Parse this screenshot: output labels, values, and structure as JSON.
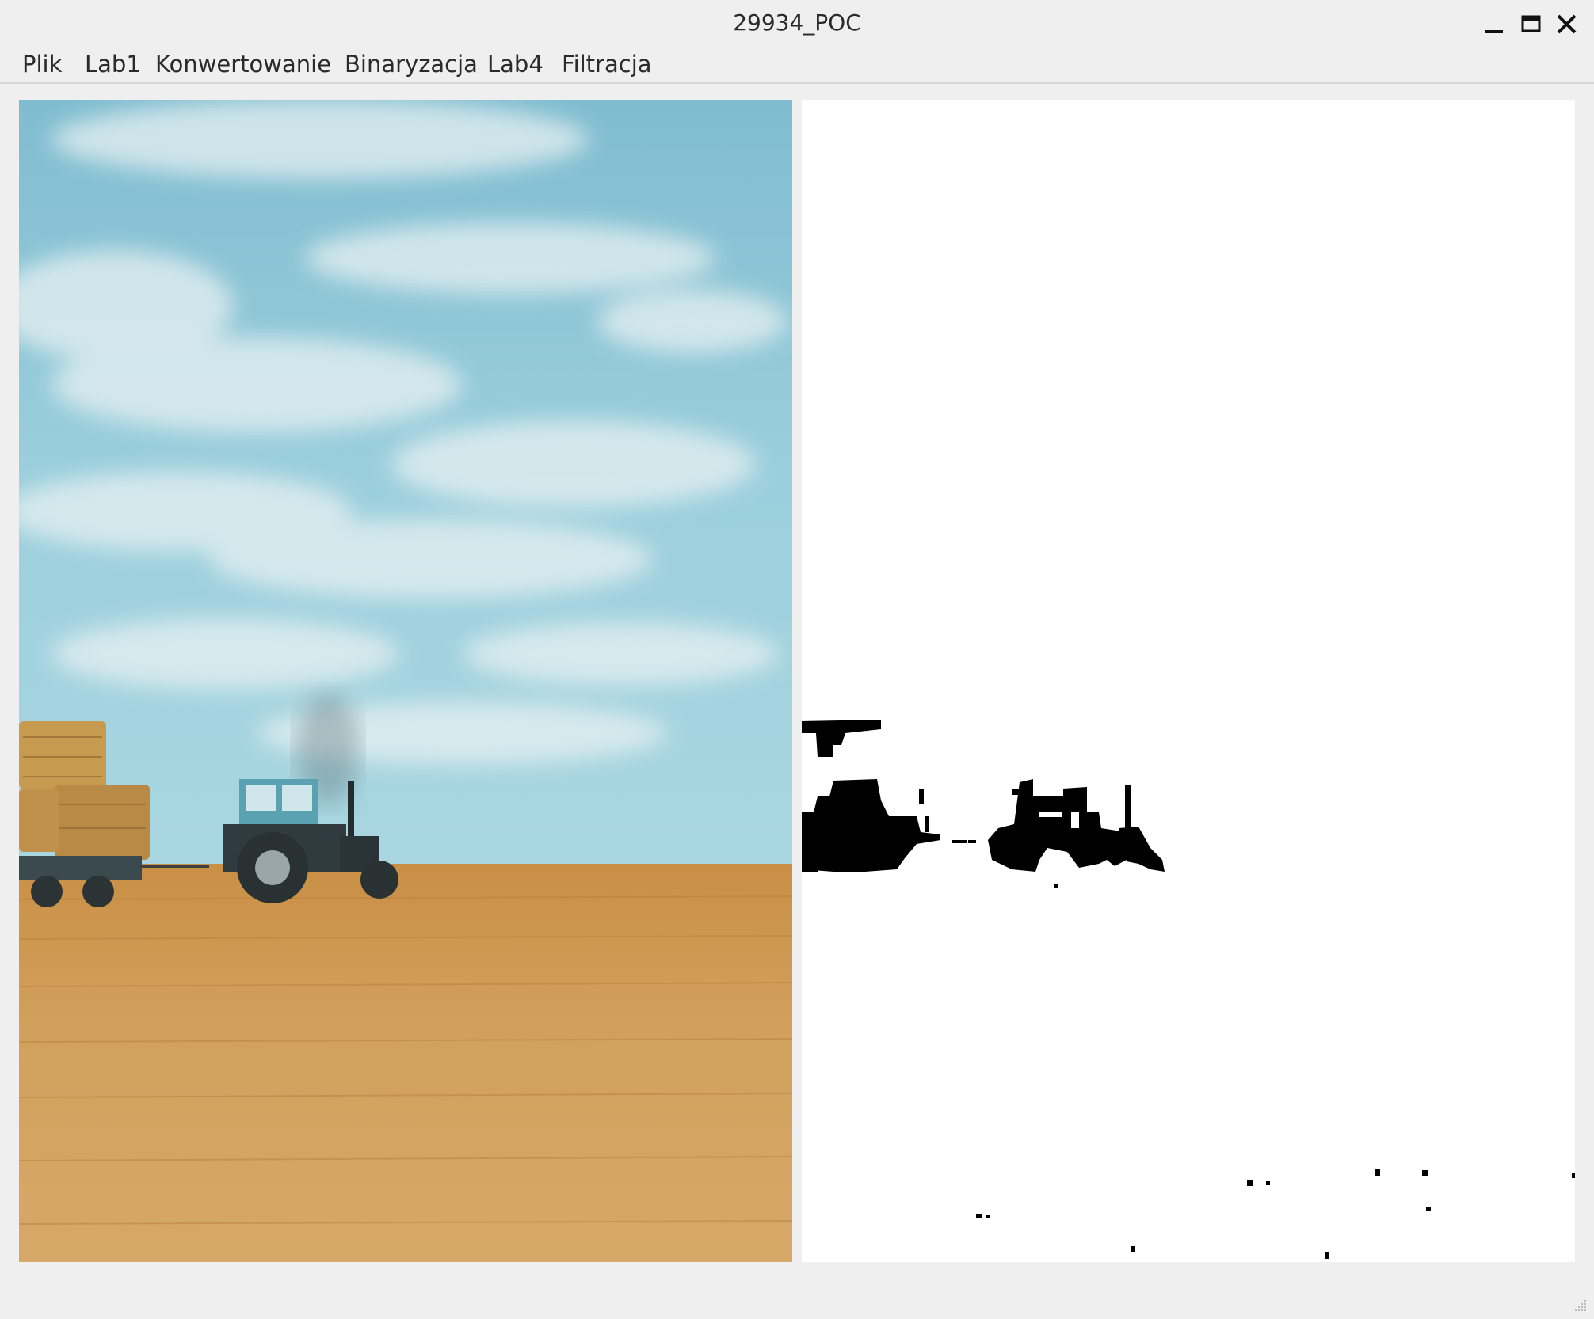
{
  "window": {
    "title": "29934_POC",
    "controls": {
      "minimize_icon": "minimize-icon",
      "maximize_icon": "maximize-icon",
      "close_icon": "close-icon"
    }
  },
  "menubar": {
    "items": [
      {
        "label": "Plik"
      },
      {
        "label": "Lab1"
      },
      {
        "label": "Konwertowanie"
      },
      {
        "label": "Binaryzacja"
      },
      {
        "label": "Lab4"
      },
      {
        "label": "Filtracja"
      }
    ]
  },
  "panels": {
    "original": {
      "content": "photo: tractor pulling hay-bale trailer across wheat field under cloudy sky"
    },
    "binarized": {
      "content": "black-and-white thresholded result"
    }
  },
  "colors": {
    "window_bg": "#efefef",
    "sky": "#8fc7d8",
    "field": "#c99a52",
    "binary_fg": "#000000",
    "binary_bg": "#ffffff"
  }
}
